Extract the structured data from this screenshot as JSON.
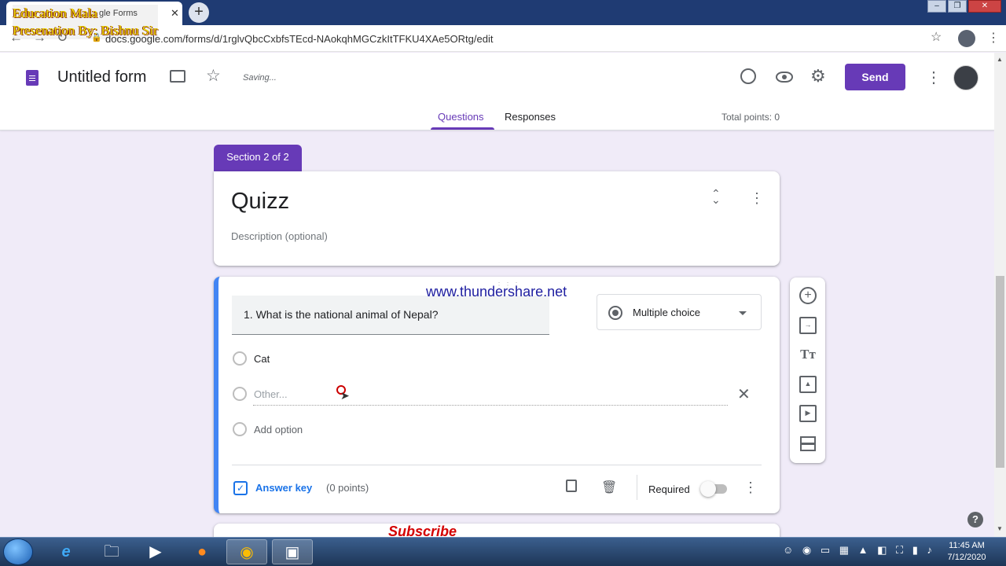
{
  "watermark": {
    "line1": "Education Mala",
    "line2": "Presenation By: Bishnu Sir"
  },
  "browser": {
    "tab_title": "gle Forms",
    "url": "docs.google.com/forms/d/1rglvQbcCxbfsTEcd-NAokqhMGCzkItTFKU4XAe5ORtg/edit"
  },
  "header": {
    "form_title": "Untitled form",
    "saving_status": "Saving...",
    "send_label": "Send",
    "tabs": [
      {
        "label": "Questions"
      },
      {
        "label": "Responses"
      }
    ],
    "total_points": "Total points: 0"
  },
  "section": {
    "badge": "Section 2 of 2",
    "title": "Quizz",
    "description_placeholder": "Description (optional)"
  },
  "question": {
    "text": "1. What is the national animal of Nepal?",
    "type": "Multiple choice",
    "options": [
      {
        "label": "Cat"
      },
      {
        "label": "Other..."
      }
    ],
    "add_option_label": "Add option",
    "answer_key_label": "Answer key",
    "points_label": "(0 points)",
    "required_label": "Required",
    "required": false
  },
  "overlay": {
    "site": "www.thundershare.net",
    "subscribe": "Subscribe"
  },
  "taskbar": {
    "time": "11:45 AM",
    "date": "7/12/2020"
  },
  "colors": {
    "accent": "#673ab7",
    "question_border": "#4285f4",
    "link": "#1a73e8",
    "background": "#f0ebf8"
  },
  "icons": [
    "forms-doc-icon",
    "folder-icon",
    "star-icon",
    "palette-icon",
    "preview-eye-icon",
    "settings-gear-icon",
    "more-vert-icon",
    "collapse-icon",
    "close-icon",
    "copy-icon",
    "trash-icon",
    "add-question-icon",
    "import-icon",
    "title-text-icon",
    "image-icon",
    "video-icon",
    "section-icon",
    "help-icon"
  ]
}
